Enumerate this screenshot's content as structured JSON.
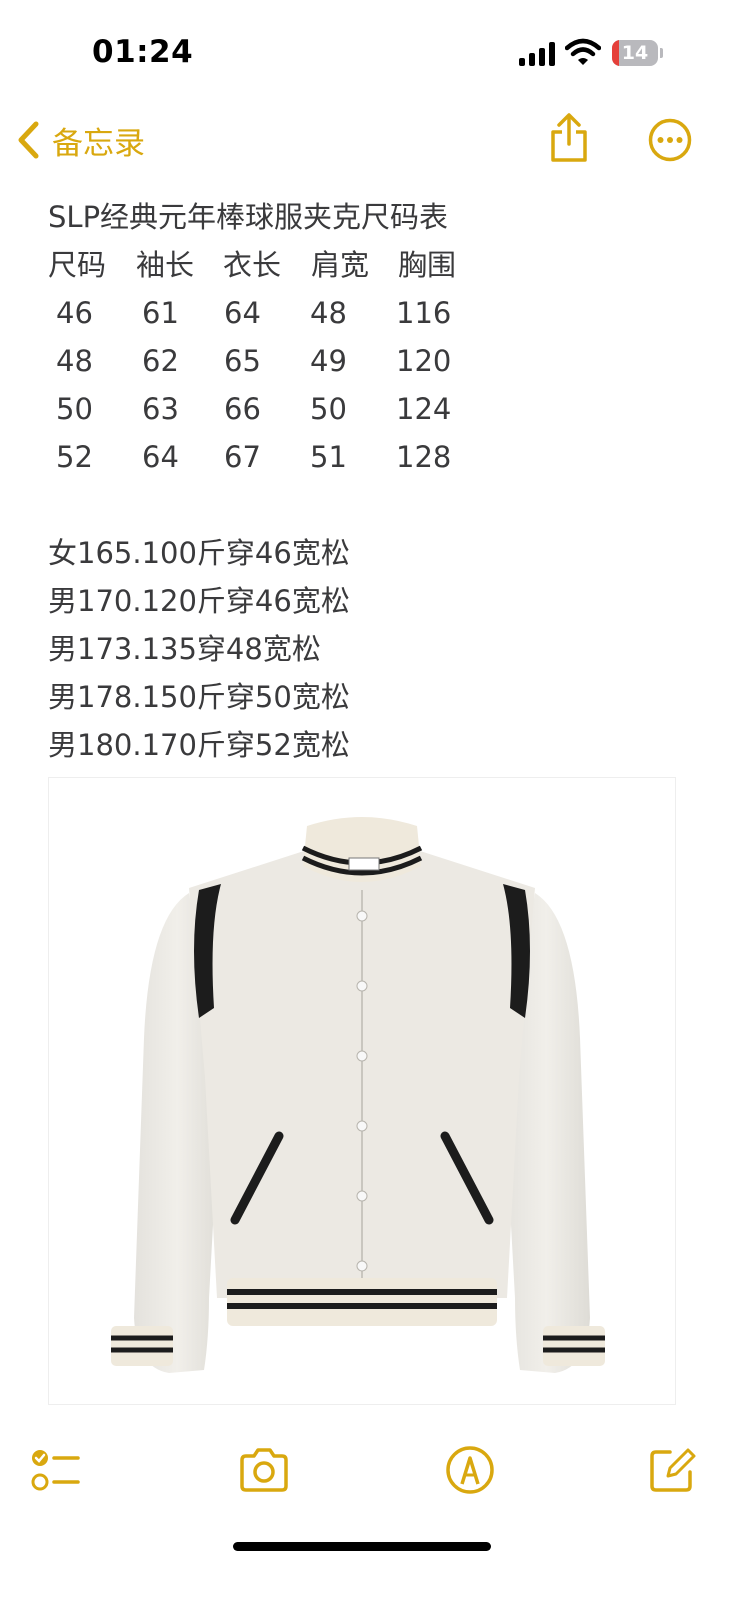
{
  "status_bar": {
    "time": "01:24",
    "battery_level": "14"
  },
  "nav": {
    "back_label": "备忘录",
    "back_icon": "chevron-left-icon",
    "share_icon": "share-icon",
    "more_icon": "ellipsis-circle-icon"
  },
  "note": {
    "title": "SLP经典元年棒球服夹克尺码表",
    "table": {
      "headers": [
        "尺码",
        "袖长",
        "衣长",
        "肩宽",
        "胸围"
      ],
      "rows": [
        [
          "46",
          "61",
          "64",
          "48",
          "116"
        ],
        [
          "48",
          "62",
          "65",
          "49",
          "120"
        ],
        [
          "50",
          "63",
          "66",
          "50",
          "124"
        ],
        [
          "52",
          "64",
          "67",
          "51",
          "128"
        ]
      ]
    },
    "fit_notes": [
      "女165.100斤穿46宽松",
      "男170.120斤穿46宽松",
      "男173.135穿48宽松",
      "男178.150斤穿50宽松",
      "男180.170斤穿52宽松"
    ]
  },
  "image": {
    "subject": "white varsity jacket with black leather trim"
  },
  "toolbar": {
    "icons": [
      "checklist-icon",
      "camera-icon",
      "markup-pen-icon",
      "compose-icon"
    ]
  },
  "colors": {
    "accent": "#d9a80f",
    "text": "#3a3a3c",
    "battery_low": "#e5403a"
  }
}
